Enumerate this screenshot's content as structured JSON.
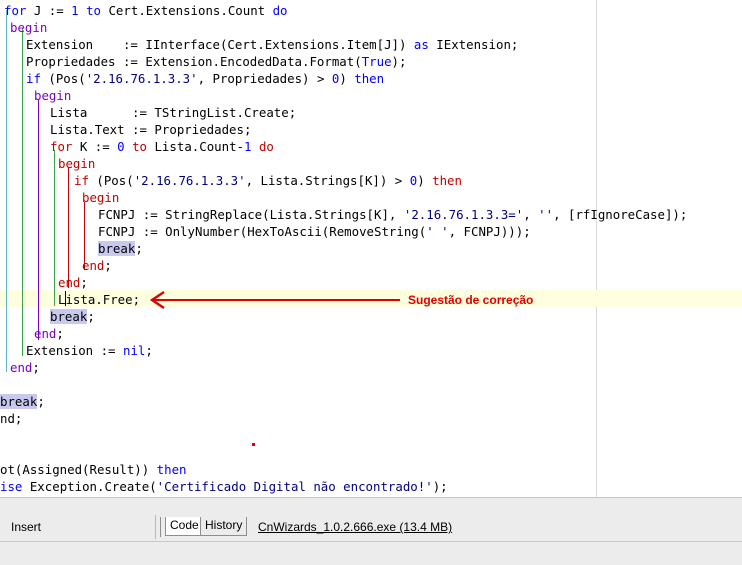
{
  "editor": {
    "annotation": "Sugestão de correção",
    "lines": [
      [
        [
          "for",
          "kw"
        ],
        [
          " J := ",
          ""
        ],
        [
          "1",
          "num"
        ],
        [
          " ",
          ""
        ],
        [
          "to",
          "kw"
        ],
        [
          " Cert.Extensions.Count ",
          ""
        ],
        [
          "do",
          "kw"
        ]
      ],
      [
        [
          "begin",
          "kw-b"
        ]
      ],
      [
        [
          "Extension    := IInterface(Cert.Extensions.Item[J]) ",
          ""
        ],
        [
          "as",
          "kw"
        ],
        [
          " IExtension;",
          ""
        ]
      ],
      [
        [
          "Propriedades := Extension.EncodedData.Format(",
          ""
        ],
        [
          "True",
          "kw"
        ],
        [
          ");",
          ""
        ]
      ],
      [
        [
          "if",
          "kw"
        ],
        [
          " (Pos(",
          ""
        ],
        [
          "'2.16.76.1.3.3'",
          "str"
        ],
        [
          ", Propriedades) > ",
          ""
        ],
        [
          "0",
          "num"
        ],
        [
          ") ",
          ""
        ],
        [
          "then",
          "kw"
        ]
      ],
      [
        [
          "begin",
          "kw-b"
        ]
      ],
      [
        [
          "Lista      := TStringList.Create;",
          ""
        ]
      ],
      [
        [
          "Lista.Text := Propriedades;",
          ""
        ]
      ],
      [
        [
          "for",
          "kw-r"
        ],
        [
          " K := ",
          ""
        ],
        [
          "0",
          "num"
        ],
        [
          " ",
          ""
        ],
        [
          "to",
          "kw-r"
        ],
        [
          " Lista.Count-",
          ""
        ],
        [
          "1",
          "num"
        ],
        [
          " ",
          ""
        ],
        [
          "do",
          "kw-r"
        ]
      ],
      [
        [
          "begin",
          "kw-r"
        ]
      ],
      [
        [
          "if",
          "kw-r"
        ],
        [
          " (Pos(",
          ""
        ],
        [
          "'2.16.76.1.3.3'",
          "str"
        ],
        [
          ", Lista.Strings[K]) > ",
          ""
        ],
        [
          "0",
          "num"
        ],
        [
          ") ",
          ""
        ],
        [
          "then",
          "kw-r"
        ]
      ],
      [
        [
          "begin",
          "kw-r"
        ]
      ],
      [
        [
          "FCNPJ := StringReplace(Lista.Strings[K], ",
          ""
        ],
        [
          "'2.16.76.1.3.3='",
          "str"
        ],
        [
          ", ",
          ""
        ],
        [
          "''",
          "str"
        ],
        [
          ", [rfIgnoreCase]);",
          ""
        ]
      ],
      [
        [
          "FCNPJ := OnlyNumber(HexToAscii(RemoveString(",
          ""
        ],
        [
          "' '",
          "str"
        ],
        [
          ", FCNPJ)));",
          ""
        ]
      ],
      [
        [
          "break",
          "brk"
        ],
        [
          ";",
          ""
        ]
      ],
      [
        [
          "end",
          "kw-r"
        ],
        [
          ";",
          ""
        ]
      ],
      [
        [
          "end",
          "kw-r"
        ],
        [
          ";",
          ""
        ]
      ],
      [
        [
          "Lista.Free;",
          ""
        ]
      ],
      [
        [
          "break",
          "brk"
        ],
        [
          ";",
          ""
        ]
      ],
      [
        [
          "end",
          "kw-b"
        ],
        [
          ";",
          ""
        ]
      ],
      [
        [
          "Extension := ",
          ""
        ],
        [
          "nil",
          "kw"
        ],
        [
          ";",
          ""
        ]
      ],
      [
        [
          "end",
          "kw-b"
        ],
        [
          ";",
          ""
        ]
      ],
      [
        [
          "",
          ""
        ]
      ],
      [
        [
          "break",
          "brk"
        ],
        [
          ";",
          ""
        ]
      ],
      [
        [
          "nd;",
          ""
        ]
      ],
      [
        [
          "",
          ""
        ]
      ],
      [
        [
          "",
          ""
        ]
      ],
      [
        [
          "ot(Assigned(Result)) ",
          ""
        ],
        [
          "then",
          "kw"
        ]
      ],
      [
        [
          "ise",
          "kw"
        ],
        [
          " Exception.Create(",
          ""
        ],
        [
          "'Certificado Digital não encontrado!'",
          "str"
        ],
        [
          ");",
          ""
        ]
      ]
    ]
  },
  "statusbar": {
    "mode": "Insert",
    "tabs": [
      "Code",
      "History"
    ],
    "file": "CnWizards_1.0.2.666.exe (13.4 MB)"
  },
  "colors": {
    "keyword": "#0000ff",
    "block": "#7b00c6",
    "inner_block": "#c00000",
    "annotation": "#e00000",
    "current_line": "#ffffe0"
  }
}
